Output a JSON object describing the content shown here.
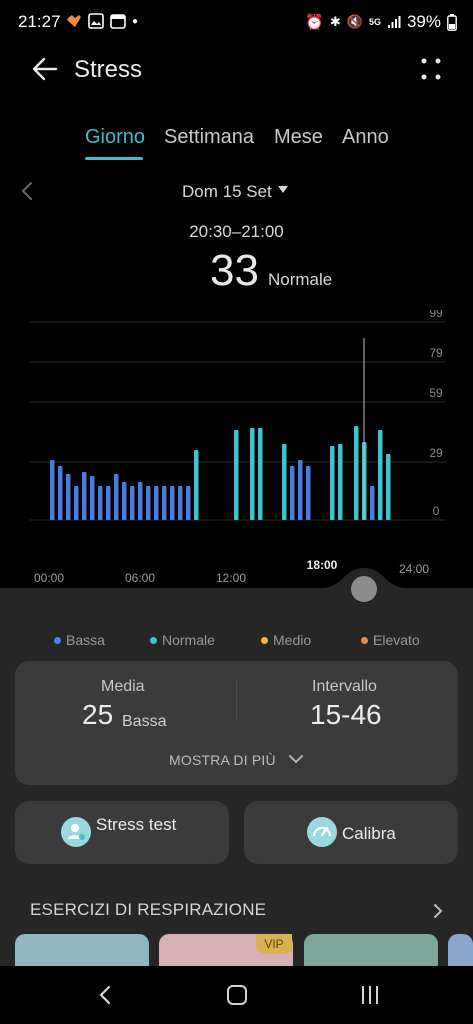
{
  "status": {
    "time": "21:27",
    "battery": "39%",
    "network": "5G"
  },
  "header": {
    "title": "Stress",
    "icons": [
      "arrow-left-icon",
      "more-dots-icon"
    ]
  },
  "tabs": [
    {
      "label": "Giorno",
      "active": true
    },
    {
      "label": "Settimana",
      "active": false
    },
    {
      "label": "Mese",
      "active": false
    },
    {
      "label": "Anno",
      "active": false
    }
  ],
  "date": {
    "label": "Dom 15 Set"
  },
  "reading": {
    "range": "20:30–21:00",
    "value": "33",
    "level": "Normale"
  },
  "chart_data": {
    "type": "bar",
    "y_ticks": [
      "99",
      "79",
      "59",
      "29",
      "0"
    ],
    "x_ticks": [
      "00:00",
      "06:00",
      "12:00",
      "18:00",
      "24:00"
    ],
    "selected_x": "18:00",
    "ylim": [
      0,
      99
    ],
    "series": [
      {
        "level": "Bassa",
        "color": "#4a7be0"
      },
      {
        "level": "Normale",
        "color": "#3cc4cf"
      }
    ],
    "bars": [
      {
        "x": 1.0,
        "v": 30,
        "l": "b"
      },
      {
        "x": 1.5,
        "v": 27,
        "l": "b"
      },
      {
        "x": 2.0,
        "v": 23,
        "l": "b"
      },
      {
        "x": 2.5,
        "v": 17,
        "l": "b"
      },
      {
        "x": 3.0,
        "v": 24,
        "l": "b"
      },
      {
        "x": 3.5,
        "v": 22,
        "l": "b"
      },
      {
        "x": 4.0,
        "v": 17,
        "l": "b"
      },
      {
        "x": 4.5,
        "v": 17,
        "l": "b"
      },
      {
        "x": 5.0,
        "v": 23,
        "l": "b"
      },
      {
        "x": 5.5,
        "v": 19,
        "l": "b"
      },
      {
        "x": 6.0,
        "v": 17,
        "l": "b"
      },
      {
        "x": 6.5,
        "v": 19,
        "l": "b"
      },
      {
        "x": 7.0,
        "v": 17,
        "l": "b"
      },
      {
        "x": 7.5,
        "v": 17,
        "l": "b"
      },
      {
        "x": 8.0,
        "v": 17,
        "l": "b"
      },
      {
        "x": 8.5,
        "v": 17,
        "l": "b"
      },
      {
        "x": 9.0,
        "v": 17,
        "l": "b"
      },
      {
        "x": 9.5,
        "v": 17,
        "l": "b"
      },
      {
        "x": 10.0,
        "v": 35,
        "l": "n"
      },
      {
        "x": 12.5,
        "v": 45,
        "l": "n"
      },
      {
        "x": 13.5,
        "v": 46,
        "l": "n"
      },
      {
        "x": 14.0,
        "v": 46,
        "l": "n"
      },
      {
        "x": 15.5,
        "v": 38,
        "l": "n"
      },
      {
        "x": 16.0,
        "v": 27,
        "l": "b"
      },
      {
        "x": 16.5,
        "v": 30,
        "l": "b"
      },
      {
        "x": 17.0,
        "v": 27,
        "l": "b"
      },
      {
        "x": 18.5,
        "v": 37,
        "l": "n"
      },
      {
        "x": 19.0,
        "v": 38,
        "l": "n"
      },
      {
        "x": 20.0,
        "v": 47,
        "l": "n"
      },
      {
        "x": 20.5,
        "v": 39,
        "l": "n"
      },
      {
        "x": 21.0,
        "v": 17,
        "l": "b"
      },
      {
        "x": 21.5,
        "v": 45,
        "l": "n"
      },
      {
        "x": 22.0,
        "v": 33,
        "l": "n"
      }
    ]
  },
  "legend": [
    {
      "label": "Bassa",
      "color": "#4a86e8"
    },
    {
      "label": "Normale",
      "color": "#3cc4cf"
    },
    {
      "label": "Medio",
      "color": "#f5b82e"
    },
    {
      "label": "Elevato",
      "color": "#f08a3c"
    }
  ],
  "stats": {
    "avg_label": "Media",
    "avg_value": "25",
    "avg_level": "Bassa",
    "range_label": "Intervallo",
    "range_value": "15-46",
    "more_label": "MOSTRA DI PIÙ"
  },
  "buttons": {
    "stress_test": "Stress test",
    "calibrate": "Calibra"
  },
  "section": {
    "title": "ESERCIZI DI RESPIRAZIONE",
    "vip": "VIP"
  }
}
